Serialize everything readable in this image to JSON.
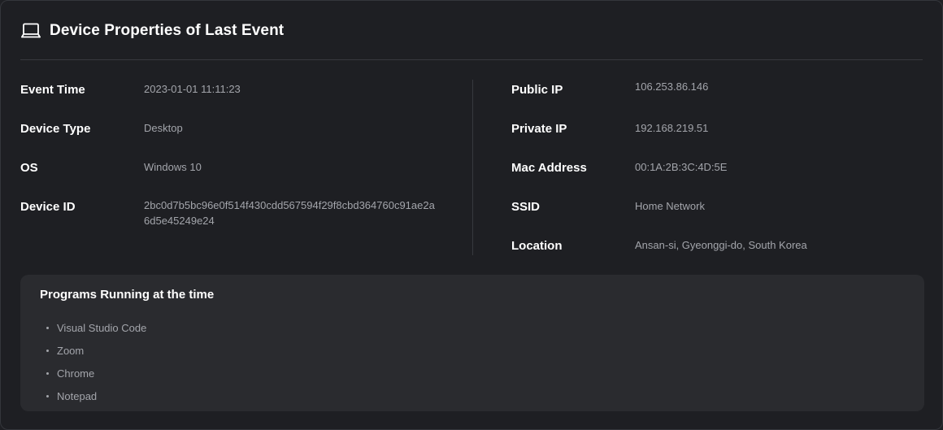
{
  "header": {
    "icon": "laptop-icon",
    "title": "Device Properties of Last Event"
  },
  "left": [
    {
      "label": "Event Time",
      "value": "2023-01-01 11:11:23"
    },
    {
      "label": "Device Type",
      "value": "Desktop"
    },
    {
      "label": "OS",
      "value": "Windows 10"
    },
    {
      "label": "Device ID",
      "value": "2bc0d7b5bc96e0f514f430cdd567594f29f8cbd364760c91ae2a6d5e45249e24"
    }
  ],
  "right": [
    {
      "label": "Public IP",
      "value": "106.253.86.146"
    },
    {
      "label": "Private IP",
      "value": "192.168.219.51"
    },
    {
      "label": "Mac Address",
      "value": "00:1A:2B:3C:4D:5E"
    },
    {
      "label": "SSID",
      "value": "Home Network"
    },
    {
      "label": "Location",
      "value": "Ansan-si, Gyeonggi-do, South Korea"
    }
  ],
  "programs": {
    "title": "Programs Running at the time",
    "items": [
      "Visual Studio Code",
      "Zoom",
      "Chrome",
      "Notepad"
    ]
  }
}
